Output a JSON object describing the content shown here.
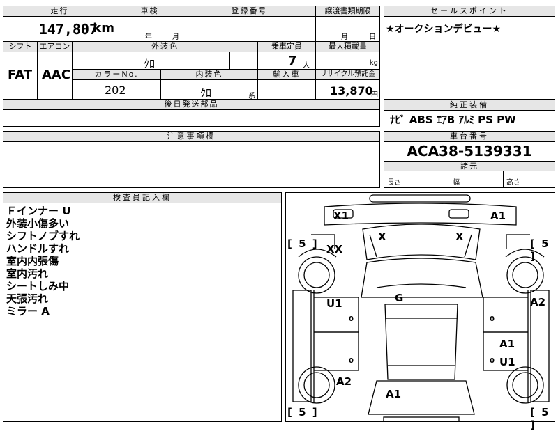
{
  "top_cut": {
    "left_text": "",
    "mid_text": ""
  },
  "vehicle": {
    "mileage_label": "走行",
    "mileage": "147,807",
    "mileage_unit": "km",
    "inspection_label": "車検",
    "inspection_year": "年",
    "inspection_month": "月",
    "registration_label": "登録番号",
    "transfer_label": "譲渡書類期限",
    "transfer_month": "月",
    "transfer_day": "日",
    "shift_label": "シフト",
    "shift": "FAT",
    "ac_label": "エアコン",
    "ac": "AAC",
    "ext_color_label": "外装色",
    "ext_color": "ｸﾛ",
    "capacity_label": "乗車定員",
    "capacity": "7",
    "capacity_unit": "人",
    "load_label": "最大積載量",
    "load_unit": "kg",
    "color_no_label": "カラーNo.",
    "color_no": "202",
    "int_color_label": "内装色",
    "int_color": "ｸﾛ",
    "int_color_unit": "系",
    "import_label": "輸入車",
    "recycle_label": "リサイクル預託金",
    "recycle": "13,870",
    "recycle_unit": "円",
    "later_parts_label": "後日発送部品"
  },
  "sales_point": {
    "label": "セールスポイント",
    "text": "★オークションデビュー★"
  },
  "equipment": {
    "label": "純正装備",
    "items": "ﾅﾋﾞ ABS ｴｱB ｱﾙﾐ PS PW"
  },
  "caution": {
    "label": "注意事項欄"
  },
  "chassis": {
    "label": "車台番号",
    "number": "ACA38-5139331",
    "dims_label": "諸元",
    "length": "長さ",
    "width": "幅",
    "height": "高さ"
  },
  "inspector": {
    "label": "検査員記入欄",
    "notes": [
      "Ｆインナー U",
      "外装小傷多い",
      "シフトノブすれ",
      "ハンドルすれ",
      "室内内張傷",
      "室内汚れ",
      "シートしみ中",
      "天張汚れ",
      "ミラー A"
    ]
  },
  "diagram": {
    "marks": {
      "x1": "X1",
      "a1_top": "A1",
      "x_left": "X",
      "x_right": "X",
      "xx": "XX",
      "g": "G",
      "u1_left": "U1",
      "a2_right": "A2",
      "a1_right": "A1",
      "u1_right": "U1",
      "a2_left": "A2",
      "a1_bottom": "A1"
    },
    "tread": {
      "top_left": "[ 5 ]",
      "top_right": "[ 5 ]",
      "bottom_left": "[ 5 ]",
      "bottom_right": "[ 5 ]"
    },
    "small_zero_left_1": "0",
    "small_zero_left_2": "0",
    "small_zero_right_1": "0",
    "small_zero_right_2": "0"
  }
}
